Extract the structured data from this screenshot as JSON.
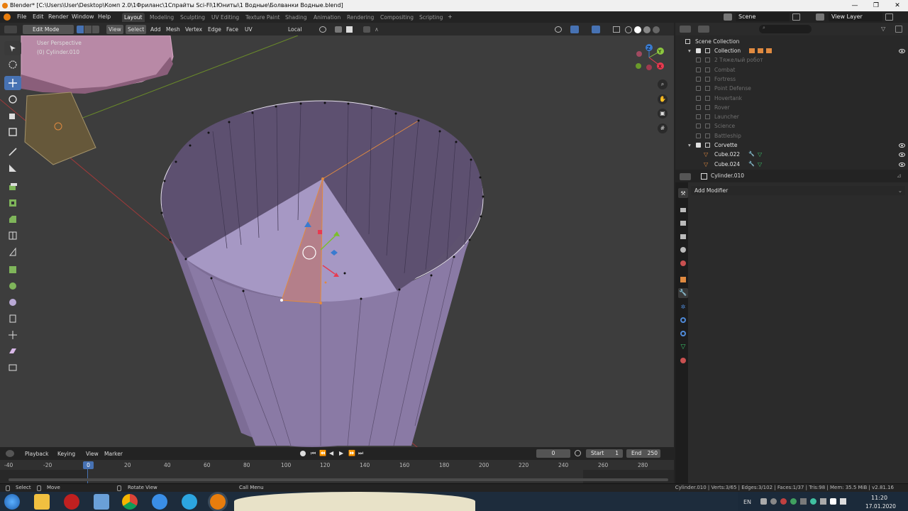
{
  "titlebar": {
    "title": "Blender* [C:\\Users\\User\\Desktop\\Комп 2.0\\1Фриланс\\1Спрайты Sci-Fi\\1Юниты\\1 Водные\\Болванки Водные.blend]"
  },
  "menus": [
    "File",
    "Edit",
    "Render",
    "Window",
    "Help"
  ],
  "workspaces": [
    "Layout",
    "Modeling",
    "Sculpting",
    "UV Editing",
    "Texture Paint",
    "Shading",
    "Animation",
    "Rendering",
    "Compositing",
    "Scripting"
  ],
  "active_workspace": "Layout",
  "scene": {
    "name": "Scene",
    "view_layer": "View Layer"
  },
  "viewport_header": {
    "mode": "Edit Mode",
    "menus": [
      "View",
      "Select",
      "Add",
      "Mesh",
      "Vertex",
      "Edge",
      "Face",
      "UV"
    ],
    "orientation": "Local"
  },
  "viewport": {
    "perspective": "User Perspective",
    "object": "(0) Cylinder.010"
  },
  "gizmo": {
    "x": "X",
    "y": "Y",
    "z": "Z"
  },
  "outliner": {
    "root": "Scene Collection",
    "rows": [
      {
        "label": "Collection",
        "checked": true,
        "dim": false,
        "eye": true
      },
      {
        "label": "2 Тяжелый робот",
        "checked": false,
        "dim": true,
        "eye": false
      },
      {
        "label": "Combat",
        "checked": false,
        "dim": true,
        "eye": false
      },
      {
        "label": "Fortress",
        "checked": false,
        "dim": true,
        "eye": false
      },
      {
        "label": "Point Defense",
        "checked": false,
        "dim": true,
        "eye": false
      },
      {
        "label": "Hovertank",
        "checked": false,
        "dim": true,
        "eye": false
      },
      {
        "label": "Rover",
        "checked": false,
        "dim": true,
        "eye": false
      },
      {
        "label": "Launcher",
        "checked": false,
        "dim": true,
        "eye": false
      },
      {
        "label": "Science",
        "checked": false,
        "dim": true,
        "eye": false
      },
      {
        "label": "Battleship",
        "checked": false,
        "dim": true,
        "eye": false
      },
      {
        "label": "Corvette",
        "checked": true,
        "dim": false,
        "eye": true
      },
      {
        "label": "Cube.022",
        "checked": false,
        "dim": false,
        "eye": true
      },
      {
        "label": "Cube.024",
        "checked": false,
        "dim": false,
        "eye": true
      }
    ]
  },
  "properties": {
    "object": "Cylinder.010",
    "add_modifier": "Add Modifier"
  },
  "timeline": {
    "menus": [
      "Playback",
      "Keying",
      "View",
      "Marker"
    ],
    "current_frame": "0",
    "start_label": "Start",
    "start": "1",
    "end_label": "End",
    "end": "250",
    "ticks": [
      "-40",
      "-20",
      "0",
      "20",
      "40",
      "60",
      "80",
      "100",
      "120",
      "140",
      "160",
      "180",
      "200",
      "220",
      "240",
      "260",
      "280"
    ]
  },
  "statusbar": {
    "select": "Select",
    "move": "Move",
    "rotate": "Rotate View",
    "call_menu": "Call Menu",
    "stats": "Cylinder.010 | Verts:3/65 | Edges:3/102 | Faces:1/37 | Tris:98 | Mem: 35.5 MiB | v2.81.16"
  },
  "taskbar": {
    "lang": "EN",
    "time": "11:20",
    "date": "17.01.2020"
  },
  "colors": {
    "accent": "#4772b3",
    "mesh": "#8a7fa8",
    "selected": "#e08a40"
  }
}
